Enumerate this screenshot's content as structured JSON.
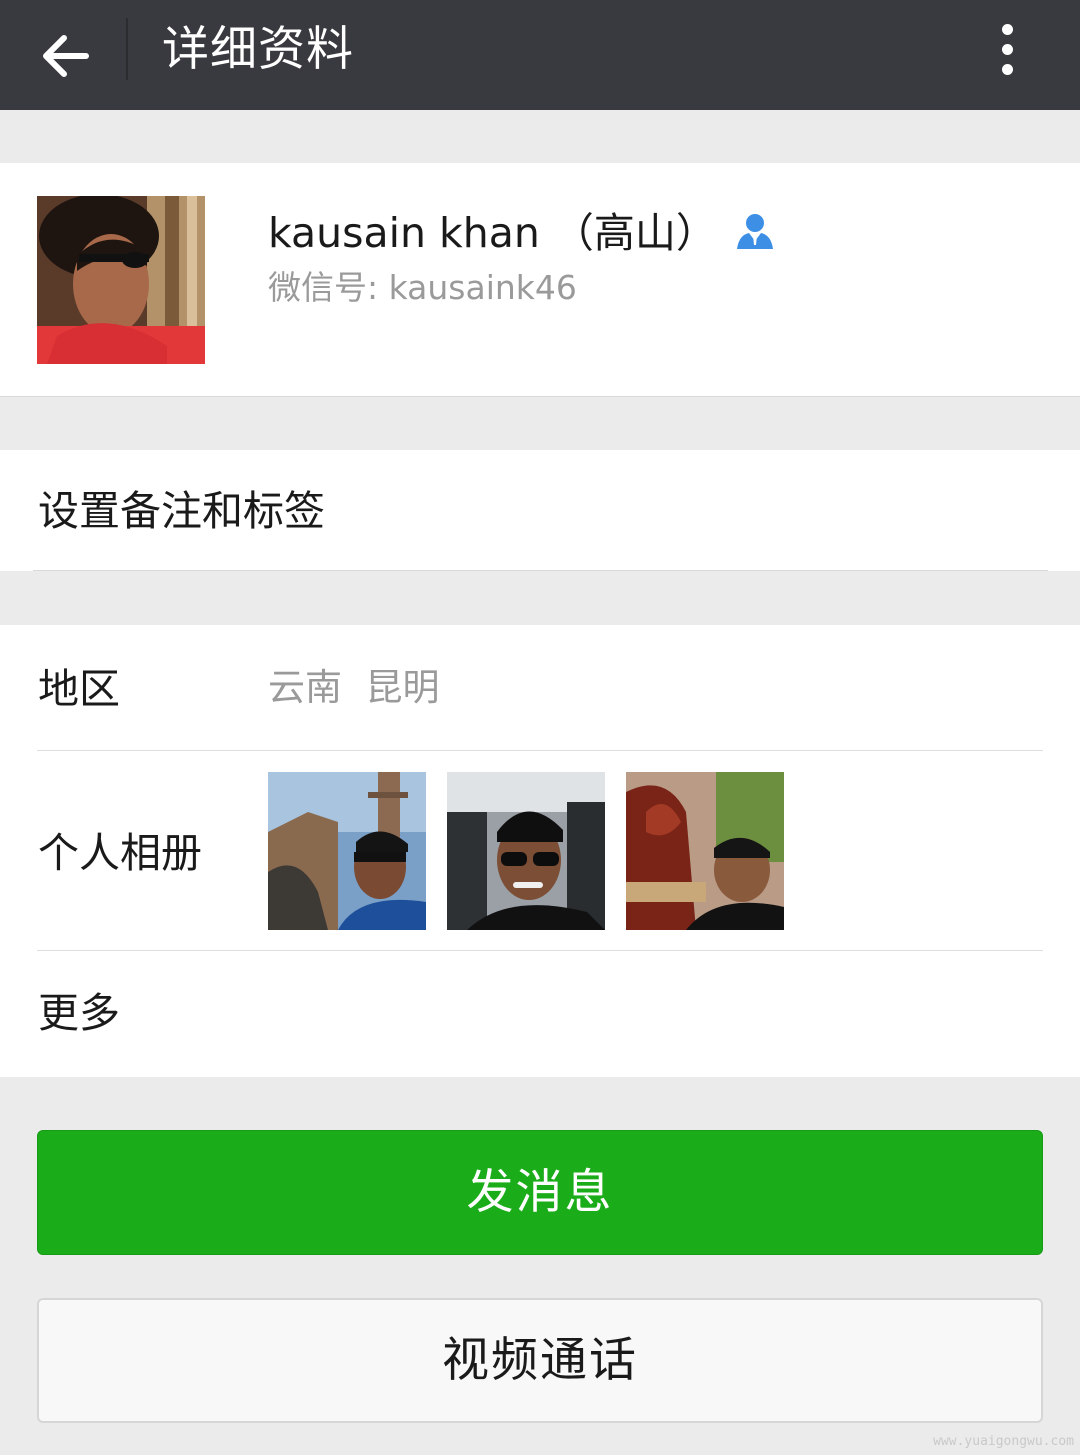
{
  "header": {
    "title": "详细资料",
    "back_icon": "arrow-left-icon",
    "more_icon": "vertical-dots-icon"
  },
  "profile": {
    "nickname": "kausain khan （高山）",
    "wechat_id": "微信号: kausaink46",
    "contact_icon": "person-icon"
  },
  "remark": {
    "label": "设置备注和标签"
  },
  "info": {
    "region_label": "地区",
    "region_value": "云南  昆明",
    "album_label": "个人相册",
    "more_label": "更多"
  },
  "actions": {
    "send_message": "发消息",
    "video_call": "视频通话"
  },
  "watermark": "www.yuaigongwu.com",
  "colors": {
    "top_bar": "#393a3f",
    "primary_green": "#1aad19",
    "background": "#ebebeb",
    "contact_icon_blue": "#3d8fe6"
  }
}
